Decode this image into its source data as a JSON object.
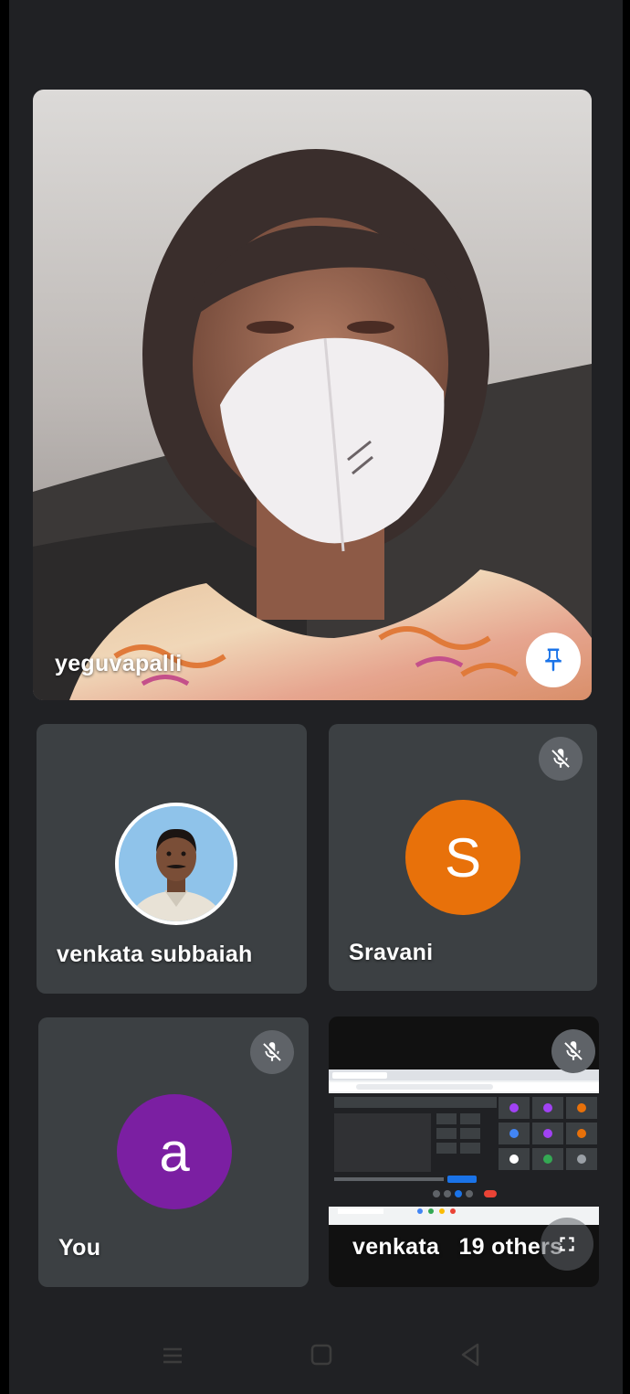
{
  "main_speaker": {
    "name": "yeguvapalli",
    "pin_icon": "pin-icon"
  },
  "participants": [
    {
      "name": "venkata subbaiah",
      "avatar_type": "photo",
      "muted": false
    },
    {
      "name": "Sravani",
      "initial": "S",
      "avatar_color": "#e8710a",
      "muted": true
    },
    {
      "name": "You",
      "initial": "a",
      "avatar_color": "#7b1fa2",
      "muted": true
    },
    {
      "name": "venkata ",
      "others_label": "19 others",
      "type": "screen-share",
      "muted": true
    }
  ],
  "icons": [
    "pin-icon",
    "mic-off-icon",
    "fullscreen-icon",
    "nav-recent-icon",
    "nav-home-icon",
    "nav-back-icon"
  ],
  "colors": {
    "background": "#202124",
    "tile": "#3c4043",
    "mute_button": "#5f6368"
  }
}
